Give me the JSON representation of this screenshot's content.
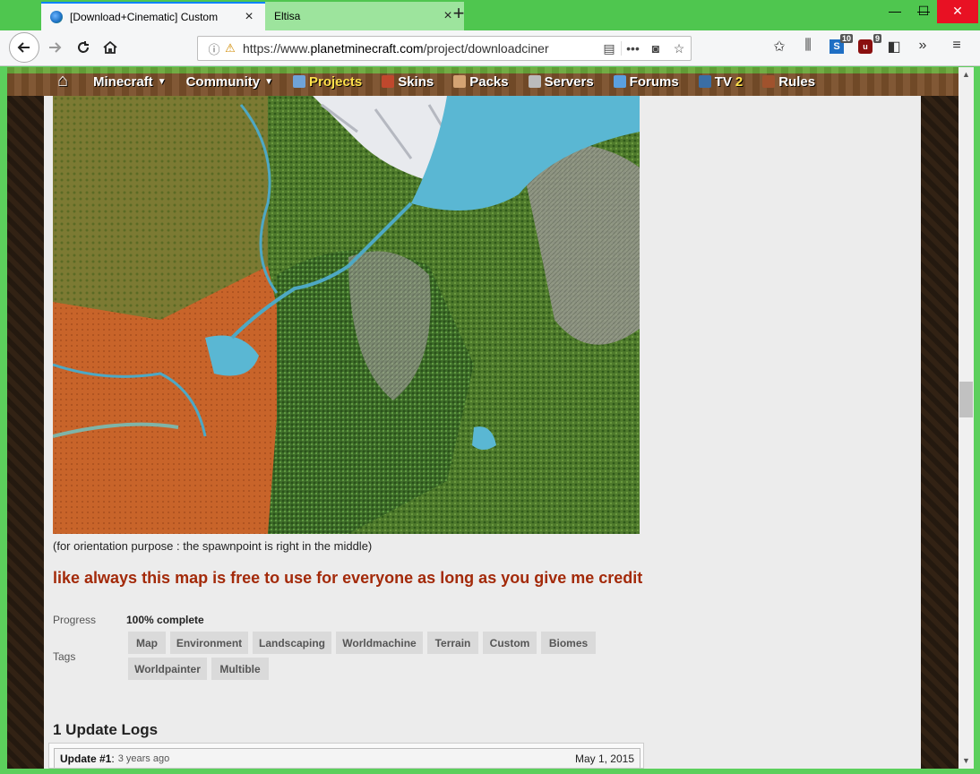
{
  "browser": {
    "tabs": [
      {
        "title": "[Download+Cinematic] Custom",
        "active": true
      },
      {
        "title": "Eltisa",
        "active": false
      }
    ],
    "new_tab": "+",
    "url": {
      "prefix": "https://www.",
      "host": "planetminecraft.com",
      "path": "/project/downloadciner"
    },
    "window_controls": {
      "minimize": "—",
      "maximize": "☐",
      "close": "✕"
    },
    "toolbar_badges": {
      "ext1": "10",
      "ext2": "9"
    }
  },
  "site_nav": {
    "items": [
      {
        "label": "Minecraft",
        "dropdown": true
      },
      {
        "label": "Community",
        "dropdown": true
      },
      {
        "label": "Projects",
        "active": true
      },
      {
        "label": "Skins"
      },
      {
        "label": "Packs"
      },
      {
        "label": "Servers"
      },
      {
        "label": "Forums"
      },
      {
        "label": "TV",
        "count": "2"
      },
      {
        "label": "Rules"
      }
    ]
  },
  "project": {
    "caption": "(for orientation purpose : the spawnpoint is right in the middle)",
    "headline": "like always this map is free to use for everyone as long as you give me credit",
    "progress_label": "Progress",
    "progress_value": "100% complete",
    "progress_fraction": 1.0,
    "tags_label": "Tags",
    "tags": [
      "Map",
      "Environment",
      "Landscaping",
      "Worldmachine",
      "Terrain",
      "Custom",
      "Biomes",
      "Worldpainter",
      "Multible"
    ]
  },
  "updates": {
    "heading": "1 Update Logs",
    "items": [
      {
        "name": "Update #1",
        "separator": " :",
        "ago": "3 years ago",
        "date": "May 1, 2015"
      }
    ]
  }
}
